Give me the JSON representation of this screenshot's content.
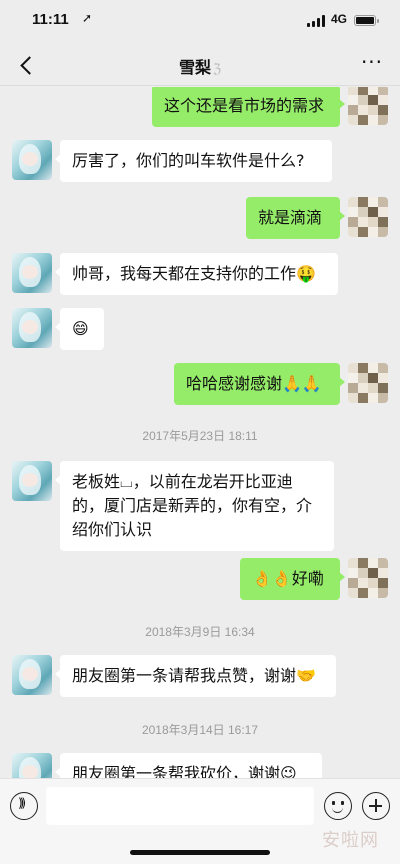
{
  "status_bar": {
    "time": "11:11",
    "location_glyph": "➚",
    "network": "4G"
  },
  "nav": {
    "title": "雪梨",
    "title_suffix_glyph": "ℨ"
  },
  "messages": [
    {
      "side": "out",
      "text": "这个还是看市场的需求"
    },
    {
      "side": "in",
      "text": "厉害了，你们的叫车软件是什么?"
    },
    {
      "side": "out",
      "text": "就是滴滴"
    },
    {
      "side": "in",
      "text": "帅哥，我每天都在支持你的工作🤑"
    },
    {
      "side": "in",
      "text": "😄"
    },
    {
      "side": "out",
      "text": "哈哈感谢感谢🙏🙏"
    },
    {
      "side": "time",
      "text": "2017年5月23日 18:11"
    },
    {
      "side": "in",
      "text": "老板姓⌴，以前在龙岩开比亚迪的，厦门店是新弄的，你有空，介绍你们认识"
    },
    {
      "side": "out",
      "text": "👌👌好嘞"
    },
    {
      "side": "time",
      "text": "2018年3月9日 16:34"
    },
    {
      "side": "in",
      "text": "朋友圈第一条请帮我点赞，谢谢🤝"
    },
    {
      "side": "time",
      "text": "2018年3月14日 16:17"
    },
    {
      "side": "in",
      "text": "朋友圈第一条帮我砍价，谢谢😉"
    }
  ],
  "watermark": "安啦网",
  "colors": {
    "background": "#ededed",
    "bubble_out": "#95ec69",
    "bubble_in": "#ffffff"
  },
  "icons": [
    "back-icon",
    "more-icon",
    "voice-icon",
    "emoji-icon",
    "plus-icon"
  ]
}
